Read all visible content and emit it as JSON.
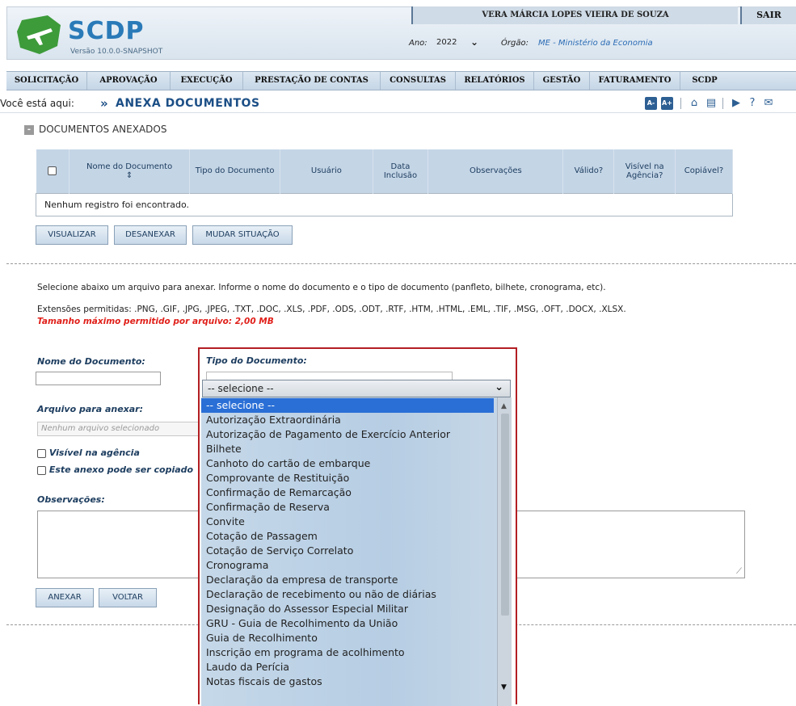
{
  "header": {
    "app_name": "SCDP",
    "version": "Versão 10.0.0-SNAPSHOT",
    "user_name": "VERA MÁRCIA LOPES VIEIRA DE SOUZA",
    "logout": "SAIR",
    "ano_label": "Ano:",
    "ano_value": "2022",
    "orgao_label": "Órgão:",
    "orgao_value": "ME - Ministério da Economia"
  },
  "nav": {
    "items": [
      "SOLICITAÇÃO",
      "APROVAÇÃO",
      "EXECUÇÃO",
      "PRESTAÇÃO DE CONTAS",
      "CONSULTAS",
      "RELATÓRIOS",
      "GESTÃO",
      "FATURAMENTO",
      "SCDP"
    ]
  },
  "breadcrumb": {
    "label": "Você está aqui:",
    "arrow": "»",
    "title": "ANEXA DOCUMENTOS",
    "font_decrease": "A-",
    "font_increase": "A+",
    "icons": [
      "home-icon",
      "chat-icon",
      "video-icon",
      "help-icon",
      "mail-icon"
    ]
  },
  "section": {
    "toggle": "-",
    "title": "DOCUMENTOS ANEXADOS"
  },
  "table": {
    "columns": [
      "Nome do Documento",
      "Tipo do Documento",
      "Usuário",
      "Data Inclusão",
      "Observações",
      "Válido?",
      "Visível na Agência?",
      "Copiável?"
    ],
    "sort_icon": "⇕",
    "empty_message": "Nenhum registro foi encontrado."
  },
  "actions": {
    "visualizar": "VISUALIZAR",
    "desanexar": "DESANEXAR",
    "mudar_situacao": "MUDAR SITUAÇÃO"
  },
  "info": {
    "line1": "Selecione abaixo um arquivo para anexar. Informe o nome do documento e o tipo de documento (panfleto, bilhete, cronograma, etc).",
    "line2": "Extensões permitidas: .PNG, .GIF, .JPG, .JPEG, .TXT, .DOC, .XLS, .PDF, .ODS, .ODT, .RTF, .HTM, .HTML, .EML, .TIF, .MSG, .OFT, .DOCX, .XLSX.",
    "max_size": "Tamanho máximo permitido por arquivo: 2,00 MB"
  },
  "form": {
    "nome_label": "Nome do Documento:",
    "nome_value": "",
    "tipo_label": "Tipo do Documento:",
    "arquivo_label": "Arquivo para anexar:",
    "arquivo_placeholder": "Nenhum arquivo selecionado",
    "visivel_label": "Visível na agência",
    "copiavel_label": "Este anexo pode ser copiado",
    "obs_label": "Observações:",
    "obs_value": "",
    "anexar": "ANEXAR",
    "voltar": "VOLTAR"
  },
  "dropdown": {
    "selected": "-- selecione --",
    "options": [
      "-- selecione --",
      "Autorização Extraordinária",
      "Autorização de Pagamento de Exercício Anterior",
      "Bilhete",
      "Canhoto do cartão de embarque",
      "Comprovante de Restituição",
      "Confirmação de Remarcação",
      "Confirmação de Reserva",
      "Convite",
      "Cotação de Passagem",
      "Cotação de Serviço Correlato",
      "Cronograma",
      "Declaração da empresa de transporte",
      "Declaração de recebimento ou não de diárias",
      "Designação do Assessor Especial Militar",
      "GRU - Guia de Recolhimento da União",
      "Guia de Recolhimento",
      "Inscrição em programa de acolhimento",
      "Laudo da Perícia",
      "Notas fiscais de gastos"
    ],
    "highlight_color": "#2a6fd6",
    "border_color": "#b31e24"
  }
}
